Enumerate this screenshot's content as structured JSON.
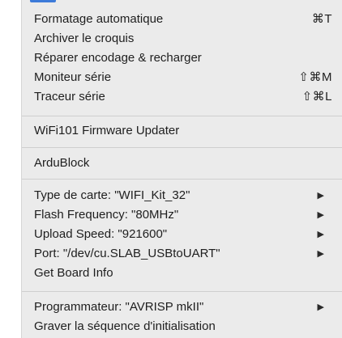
{
  "menu": {
    "groups": [
      {
        "items": [
          {
            "label": "Formatage automatique",
            "shortcut": "⌘T"
          },
          {
            "label": "Archiver le croquis",
            "shortcut": ""
          },
          {
            "label": "Réparer encodage & recharger",
            "shortcut": ""
          },
          {
            "label": "Moniteur série",
            "shortcut": "⇧⌘M"
          },
          {
            "label": "Traceur série",
            "shortcut": "⇧⌘L"
          }
        ]
      },
      {
        "items": [
          {
            "label": "WiFi101 Firmware Updater"
          }
        ]
      },
      {
        "items": [
          {
            "label": "ArduBlock"
          }
        ]
      },
      {
        "items": [
          {
            "label": "Type de carte: \"WIFI_Kit_32\"",
            "submenu": "▶"
          },
          {
            "label": "Flash Frequency: \"80MHz\"",
            "submenu": "▶"
          },
          {
            "label": "Upload Speed: \"921600\"",
            "submenu": "▶"
          },
          {
            "label": "Port: \"/dev/cu.SLAB_USBtoUART\"",
            "submenu": "▶"
          },
          {
            "label": "Get Board Info",
            "submenu": ""
          }
        ]
      },
      {
        "items": [
          {
            "label": "Programmateur: \"AVRISP mkII\"",
            "submenu": "▶"
          },
          {
            "label": "Graver la séquence d'initialisation",
            "submenu": ""
          }
        ]
      }
    ]
  },
  "colors": {
    "menu_background": "#ebebeb",
    "text": "#1e1e1e",
    "separator": "#cfcfcf",
    "accent": "#3d7bd9"
  }
}
